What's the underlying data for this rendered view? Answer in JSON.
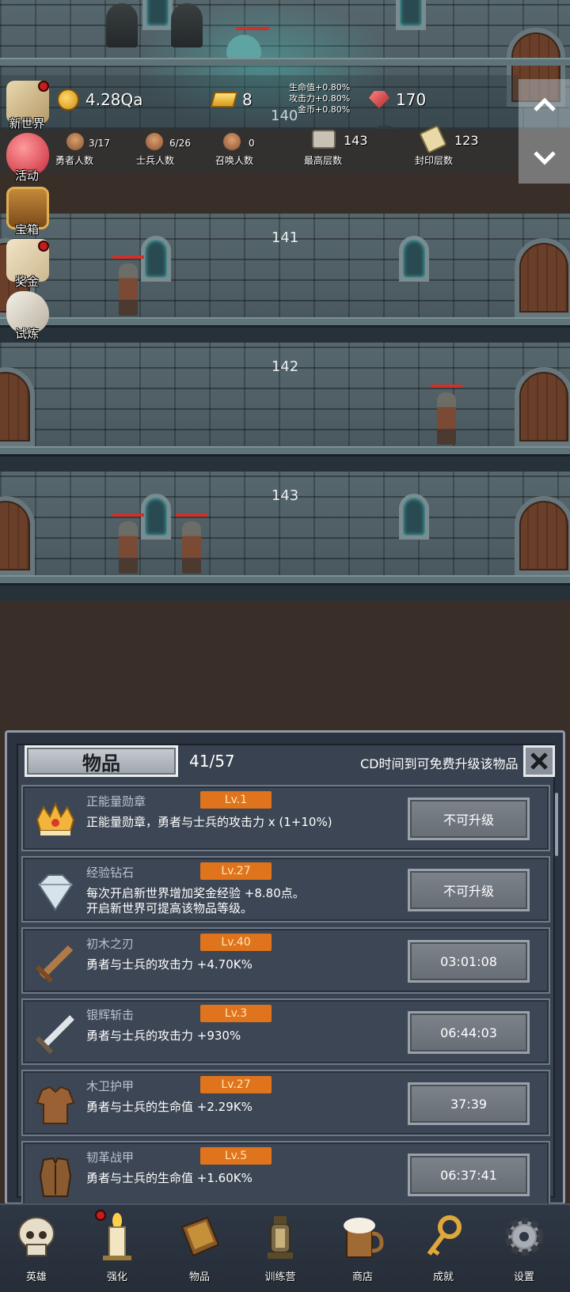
{
  "hud": {
    "gold": "4.28Qa",
    "gold_bars": "8",
    "rubies": "170",
    "bonus_hp": "生命值+0.80%",
    "bonus_atk": "攻击力+0.80%",
    "bonus_coin": "金币+0.80%",
    "heroes": {
      "value": "3/17",
      "label": "勇者人数"
    },
    "soldiers": {
      "value": "6/26",
      "label": "士兵人数"
    },
    "summons": {
      "value": "0",
      "label": "召唤人数"
    },
    "max_floor": {
      "value": "143",
      "label": "最高层数"
    },
    "sealed_floor": {
      "value": "123",
      "label": "封印层数"
    }
  },
  "floors": [
    "140",
    "141",
    "142",
    "143"
  ],
  "side_menu": [
    "新世界",
    "活动",
    "宝箱",
    "奖金",
    "试炼"
  ],
  "panel": {
    "title": "物品",
    "count": "41/57",
    "hint": "CD时间到可免费升级该物品",
    "items": [
      {
        "name": "正能量勋章",
        "level": "Lv.1",
        "desc": "正能量勋章，勇者与士兵的攻击力 x (1+10%)",
        "action": "不可升级",
        "icon": "crown-medal-icon"
      },
      {
        "name": "经验钻石",
        "level": "Lv.27",
        "desc": "每次开启新世界增加奖金经验 +8.80点。\n开启新世界可提高该物品等级。",
        "action": "不可升级",
        "icon": "diamond-icon"
      },
      {
        "name": "初木之刃",
        "level": "Lv.40",
        "desc": "勇者与士兵的攻击力 +4.70K%",
        "action": "03:01:08",
        "icon": "wooden-sword-icon"
      },
      {
        "name": "银辉斩击",
        "level": "Lv.3",
        "desc": "勇者与士兵的攻击力 +930%",
        "action": "06:44:03",
        "icon": "silver-sword-icon"
      },
      {
        "name": "木卫护甲",
        "level": "Lv.27",
        "desc": "勇者与士兵的生命值 +2.29K%",
        "action": "37:39",
        "icon": "wooden-armor-icon"
      },
      {
        "name": "韧革战甲",
        "level": "Lv.5",
        "desc": "勇者与士兵的生命值 +1.60K%",
        "action": "06:37:41",
        "icon": "leather-armor-icon"
      }
    ]
  },
  "nav": [
    "英雄",
    "强化",
    "物品",
    "训练营",
    "商店",
    "成就",
    "设置"
  ],
  "colors": {
    "level_badge": "#e0741c",
    "panel_bg": "#394250",
    "alert_dot": "#c21e1e",
    "hp_bar": "#d0302a"
  }
}
